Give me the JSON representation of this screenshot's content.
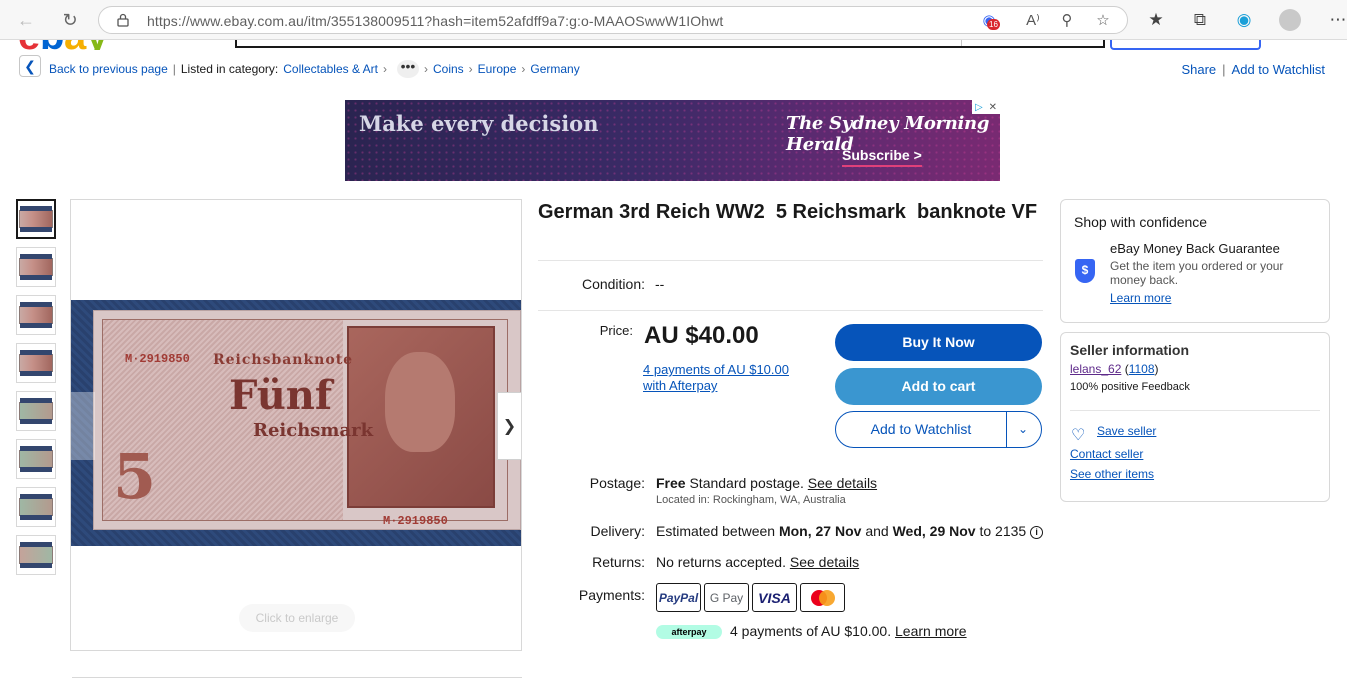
{
  "browser": {
    "url": "https://www.ebay.com.au/itm/355138009511?hash=item52afdff9a7:g:o-MAAOSwwW1IOhwt",
    "tracker_count": "16"
  },
  "header": {
    "logo": "ebay"
  },
  "breadcrumb": {
    "back_label": "Back to previous page",
    "listed_in": "Listed in category:",
    "items": [
      "Collectables & Art",
      "Coins",
      "Europe",
      "Germany"
    ],
    "more": "•••"
  },
  "top_actions": {
    "share": "Share",
    "watchlist": "Add to Watchlist"
  },
  "ad": {
    "headline": "Make every decision",
    "masthead": "The Sydney Morning Herald",
    "cta": "Subscribe >"
  },
  "gallery": {
    "thumb_count": 8,
    "enlarge": "Click to enlarge",
    "note_title": "Reichsbanknote",
    "note_serial": "M·2919850",
    "note_word": "Fünf",
    "note_value": "5",
    "note_unit": "Reichsmark"
  },
  "item": {
    "title": "German 3rd Reich WW2  5 Reichsmark  banknote VF",
    "condition_label": "Condition:",
    "condition_value": "--",
    "price_label": "Price:",
    "price": "AU $40.00",
    "afterpay_link": "4 payments of AU $10.00 with Afterpay",
    "buy_now": "Buy It Now",
    "add_to_cart": "Add to cart",
    "add_to_watchlist": "Add to Watchlist",
    "postage_label": "Postage:",
    "postage_free": "Free",
    "postage_text": "Standard postage.",
    "postage_details": "See details",
    "location": "Located in: Rockingham, WA, Australia",
    "delivery_label": "Delivery:",
    "delivery_pre": "Estimated between",
    "delivery_start": "Mon, 27 Nov",
    "delivery_and": "and",
    "delivery_end": "Wed, 29 Nov",
    "delivery_post": "to 2135",
    "returns_label": "Returns:",
    "returns_text": "No returns accepted.",
    "returns_details": "See details",
    "payments_label": "Payments:",
    "payment_methods": [
      "PayPal",
      "G Pay",
      "VISA",
      "Mastercard"
    ],
    "afterpay_badge": "afterpay",
    "afterpay_text": "4 payments of AU $10.00.",
    "afterpay_learn": "Learn more"
  },
  "confidence": {
    "title": "Shop with confidence",
    "guarantee": "eBay Money Back Guarantee",
    "desc": "Get the item you ordered or your money back.",
    "learn": "Learn more"
  },
  "seller": {
    "title": "Seller information",
    "name": "lelans_62",
    "feedback_count": "1108",
    "positive": "100% positive Feedback",
    "save": "Save seller",
    "contact": "Contact seller",
    "other": "See other items"
  },
  "colors": {
    "link": "#0654ba",
    "buy_button": "#0654ba",
    "cart_button": "#3a96d0"
  }
}
